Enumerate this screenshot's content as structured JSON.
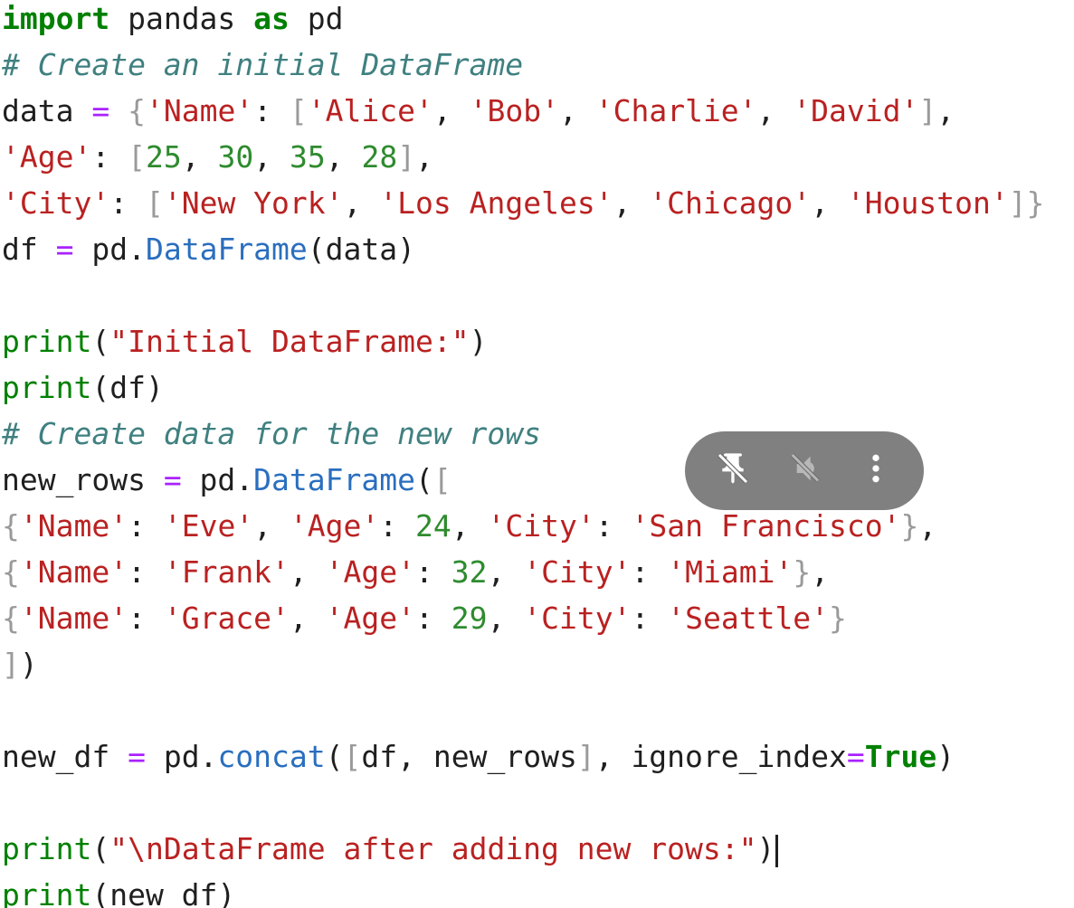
{
  "code": {
    "lines": [
      [
        [
          "kw",
          "import"
        ],
        [
          "txt",
          " pandas "
        ],
        [
          "kw",
          "as"
        ],
        [
          "txt",
          " pd"
        ]
      ],
      [
        [
          "cm",
          "# Create an initial DataFrame"
        ]
      ],
      [
        [
          "txt",
          "data "
        ],
        [
          "op",
          "="
        ],
        [
          "txt",
          " "
        ],
        [
          "br",
          "{"
        ],
        [
          "str",
          "'Name'"
        ],
        [
          "txt",
          ": "
        ],
        [
          "br",
          "["
        ],
        [
          "str",
          "'Alice'"
        ],
        [
          "txt",
          ", "
        ],
        [
          "str",
          "'Bob'"
        ],
        [
          "txt",
          ", "
        ],
        [
          "str",
          "'Charlie'"
        ],
        [
          "txt",
          ", "
        ],
        [
          "str",
          "'David'"
        ],
        [
          "br",
          "]"
        ],
        [
          "txt",
          ","
        ]
      ],
      [
        [
          "str",
          "'Age'"
        ],
        [
          "txt",
          ": "
        ],
        [
          "br",
          "["
        ],
        [
          "num",
          "25"
        ],
        [
          "txt",
          ", "
        ],
        [
          "num",
          "30"
        ],
        [
          "txt",
          ", "
        ],
        [
          "num",
          "35"
        ],
        [
          "txt",
          ", "
        ],
        [
          "num",
          "28"
        ],
        [
          "br",
          "]"
        ],
        [
          "txt",
          ","
        ]
      ],
      [
        [
          "str",
          "'City'"
        ],
        [
          "txt",
          ": "
        ],
        [
          "br",
          "["
        ],
        [
          "str",
          "'New York'"
        ],
        [
          "txt",
          ", "
        ],
        [
          "str",
          "'Los Angeles'"
        ],
        [
          "txt",
          ", "
        ],
        [
          "str",
          "'Chicago'"
        ],
        [
          "txt",
          ", "
        ],
        [
          "str",
          "'Houston'"
        ],
        [
          "br",
          "]}"
        ]
      ],
      [
        [
          "txt",
          "df "
        ],
        [
          "op",
          "="
        ],
        [
          "txt",
          " pd."
        ],
        [
          "attr",
          "DataFrame"
        ],
        [
          "txt",
          "(data)"
        ]
      ],
      [],
      [
        [
          "fn",
          "print"
        ],
        [
          "txt",
          "("
        ],
        [
          "str",
          "\"Initial DataFrame:\""
        ],
        [
          "txt",
          ")"
        ]
      ],
      [
        [
          "fn",
          "print"
        ],
        [
          "txt",
          "(df)"
        ]
      ],
      [
        [
          "cm",
          "# Create data for the new rows"
        ]
      ],
      [
        [
          "txt",
          "new_rows "
        ],
        [
          "op",
          "="
        ],
        [
          "txt",
          " pd."
        ],
        [
          "attr",
          "DataFrame"
        ],
        [
          "txt",
          "("
        ],
        [
          "br",
          "["
        ]
      ],
      [
        [
          "br",
          "{"
        ],
        [
          "str",
          "'Name'"
        ],
        [
          "txt",
          ": "
        ],
        [
          "str",
          "'Eve'"
        ],
        [
          "txt",
          ", "
        ],
        [
          "str",
          "'Age'"
        ],
        [
          "txt",
          ": "
        ],
        [
          "num",
          "24"
        ],
        [
          "txt",
          ", "
        ],
        [
          "str",
          "'City'"
        ],
        [
          "txt",
          ": "
        ],
        [
          "str",
          "'San Francisco'"
        ],
        [
          "br",
          "}"
        ],
        [
          "txt",
          ","
        ]
      ],
      [
        [
          "br",
          "{"
        ],
        [
          "str",
          "'Name'"
        ],
        [
          "txt",
          ": "
        ],
        [
          "str",
          "'Frank'"
        ],
        [
          "txt",
          ", "
        ],
        [
          "str",
          "'Age'"
        ],
        [
          "txt",
          ": "
        ],
        [
          "num",
          "32"
        ],
        [
          "txt",
          ", "
        ],
        [
          "str",
          "'City'"
        ],
        [
          "txt",
          ": "
        ],
        [
          "str",
          "'Miami'"
        ],
        [
          "br",
          "}"
        ],
        [
          "txt",
          ","
        ]
      ],
      [
        [
          "br",
          "{"
        ],
        [
          "str",
          "'Name'"
        ],
        [
          "txt",
          ": "
        ],
        [
          "str",
          "'Grace'"
        ],
        [
          "txt",
          ", "
        ],
        [
          "str",
          "'Age'"
        ],
        [
          "txt",
          ": "
        ],
        [
          "num",
          "29"
        ],
        [
          "txt",
          ", "
        ],
        [
          "str",
          "'City'"
        ],
        [
          "txt",
          ": "
        ],
        [
          "str",
          "'Seattle'"
        ],
        [
          "br",
          "}"
        ]
      ],
      [
        [
          "br",
          "]"
        ],
        [
          "txt",
          ")"
        ]
      ],
      [],
      [
        [
          "txt",
          "new_df "
        ],
        [
          "op",
          "="
        ],
        [
          "txt",
          " pd."
        ],
        [
          "attr",
          "concat"
        ],
        [
          "txt",
          "("
        ],
        [
          "br",
          "["
        ],
        [
          "txt",
          "df, new_rows"
        ],
        [
          "br",
          "]"
        ],
        [
          "txt",
          ", ignore_index"
        ],
        [
          "op",
          "="
        ],
        [
          "kw",
          "True"
        ],
        [
          "txt",
          ")"
        ]
      ],
      [],
      [
        [
          "fn",
          "print"
        ],
        [
          "txt",
          "("
        ],
        [
          "str",
          "\"\\nDataFrame after adding new rows:\""
        ],
        [
          "txt",
          ")"
        ],
        [
          "cursor",
          ""
        ]
      ],
      [
        [
          "fn",
          "print"
        ],
        [
          "txt",
          "(new_df)"
        ]
      ]
    ]
  },
  "overlay": {
    "icons": [
      "unpin-icon",
      "mute-icon",
      "more-vertical-icon"
    ],
    "icon_color": "#ffffff",
    "background": "#6e6e6e"
  }
}
